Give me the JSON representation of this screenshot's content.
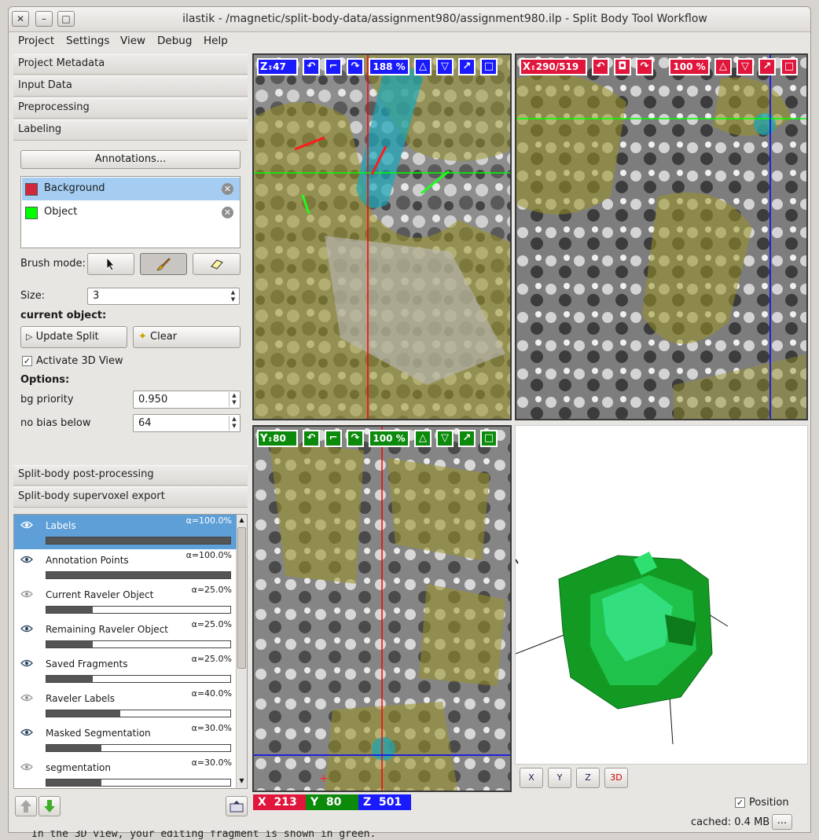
{
  "window": {
    "title": "ilastik - /magnetic/split-body-data/assignment980/assignment980.ilp - Split Body Tool Workflow",
    "close": "✕",
    "minimize": "–",
    "maximize": "□"
  },
  "menu": [
    "Project",
    "Settings",
    "View",
    "Debug",
    "Help"
  ],
  "applets": {
    "top": [
      "Project Metadata",
      "Input Data",
      "Preprocessing",
      "Labeling"
    ],
    "bottom": [
      "Split-body post-processing",
      "Split-body supervoxel export"
    ]
  },
  "labeling": {
    "annotations_button": "Annotations...",
    "labels": [
      {
        "name": "Background",
        "color": "#d0283c",
        "selected": true
      },
      {
        "name": "Object",
        "color": "#00ff00",
        "selected": false
      }
    ],
    "brush_mode_label": "Brush mode:",
    "size_label": "Size:",
    "size_value": "3",
    "current_object_label": "current object:",
    "update_split_label": "Update Split",
    "clear_label": "Clear",
    "activate_3d_label": "Activate 3D View",
    "activate_3d_checked": true,
    "options_label": "Options:",
    "bg_priority_label": "bg priority",
    "bg_priority_value": "0.950",
    "no_bias_label": "no bias below",
    "no_bias_value": "64"
  },
  "layers": [
    {
      "name": "Labels",
      "alpha": "α=100.0%",
      "opacity": 1.0,
      "visible": true,
      "selected": true
    },
    {
      "name": "Annotation Points",
      "alpha": "α=100.0%",
      "opacity": 1.0,
      "visible": true,
      "selected": false
    },
    {
      "name": "Current Raveler Object",
      "alpha": "α=25.0%",
      "opacity": 0.25,
      "visible": false,
      "selected": false
    },
    {
      "name": "Remaining Raveler Object",
      "alpha": "α=25.0%",
      "opacity": 0.25,
      "visible": true,
      "selected": false
    },
    {
      "name": "Saved Fragments",
      "alpha": "α=25.0%",
      "opacity": 0.25,
      "visible": true,
      "selected": false
    },
    {
      "name": "Raveler Labels",
      "alpha": "α=40.0%",
      "opacity": 0.4,
      "visible": false,
      "selected": false
    },
    {
      "name": "Masked Segmentation",
      "alpha": "α=30.0%",
      "opacity": 0.3,
      "visible": true,
      "selected": false
    },
    {
      "name": "segmentation",
      "alpha": "α=30.0%",
      "opacity": 0.3,
      "visible": false,
      "selected": false
    }
  ],
  "views": {
    "z": {
      "axis": "Z",
      "slice": "47",
      "zoom": "188 %",
      "color": "#1a1aff"
    },
    "x": {
      "axis": "X",
      "slice": "290/519",
      "zoom": "100 %",
      "color": "#e0163c"
    },
    "y": {
      "axis": "Y",
      "slice": "80",
      "zoom": "100 %",
      "color": "#0b8a0b"
    }
  },
  "view3d_buttons": [
    "X",
    "Y",
    "Z",
    "3D"
  ],
  "position": {
    "x_label": "X",
    "x": "213",
    "y_label": "Y",
    "y": "80",
    "z_label": "Z",
    "z": "501"
  },
  "status": {
    "position_label": "Position",
    "position_checked": true,
    "cached": "cached: 0.4 MB",
    "more": "..."
  },
  "overlay_text": "In the 3D view, your editing fragment is shown in green."
}
